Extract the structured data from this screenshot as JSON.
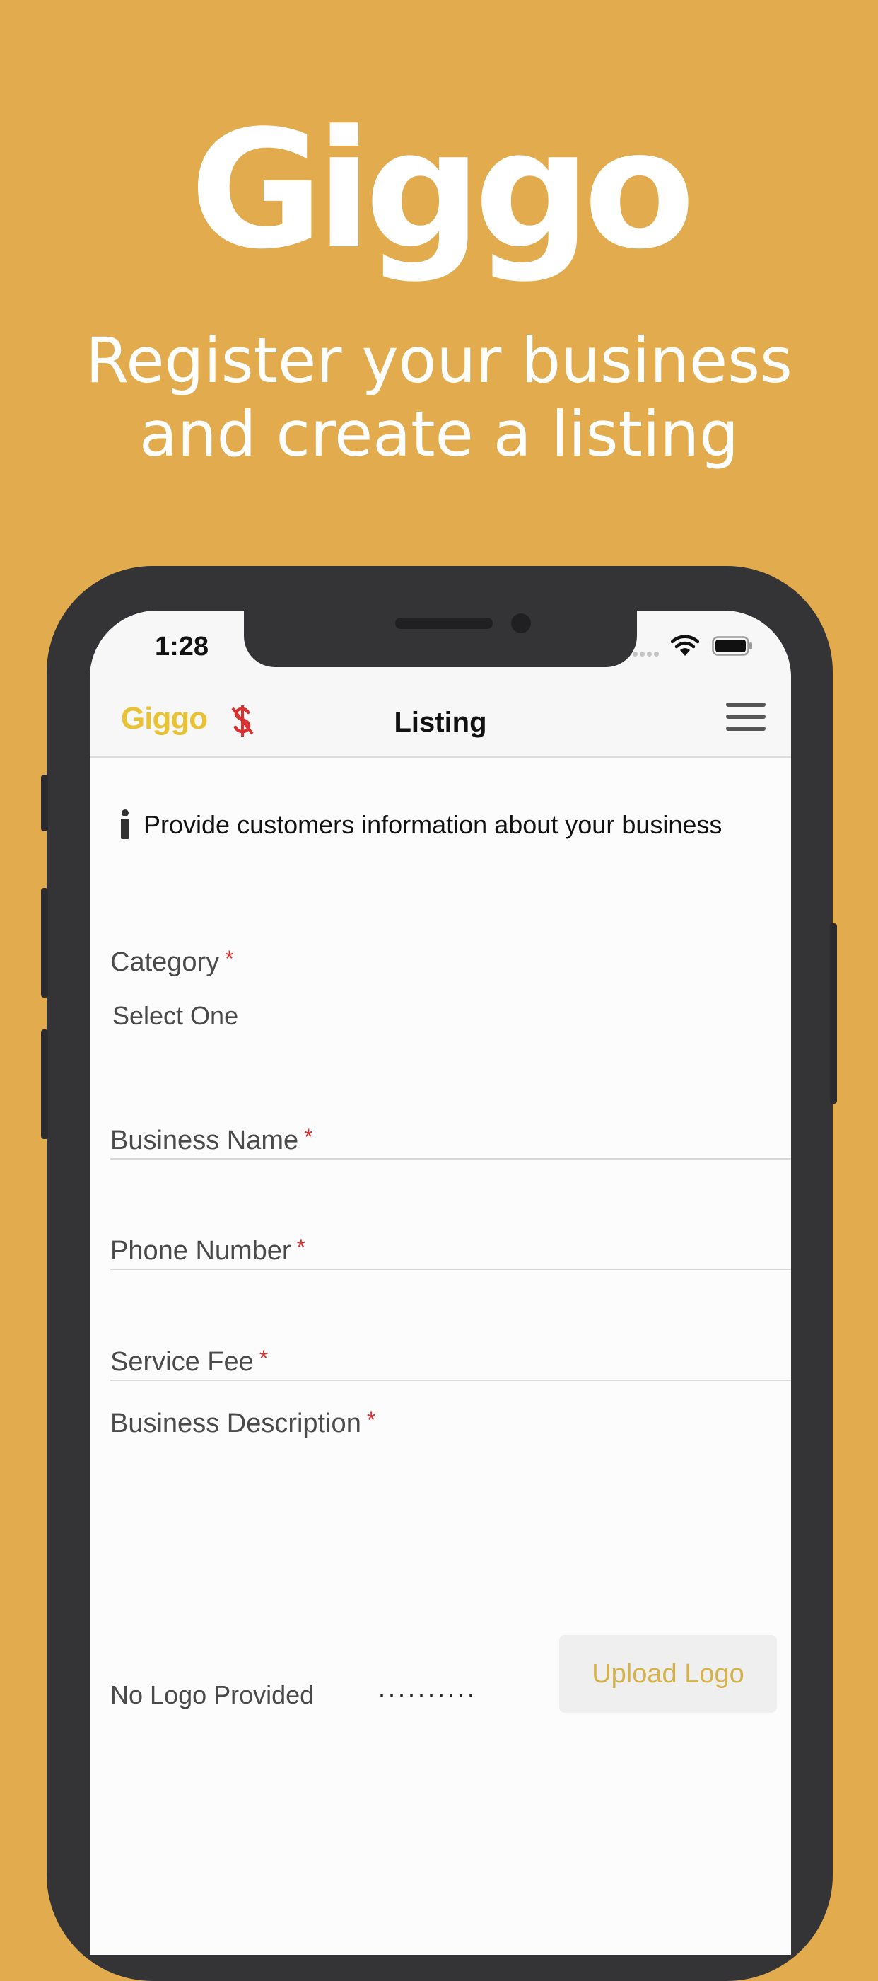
{
  "promo": {
    "logo_text": "Giggo",
    "headline": "Register your business\nand create a listing"
  },
  "status_bar": {
    "time": "1:28",
    "icons": [
      "signal-icon",
      "wifi-icon",
      "battery-icon"
    ]
  },
  "header": {
    "brand": "Giggo",
    "title": "Listing",
    "icons": [
      "dollar-icon",
      "menu-icon"
    ]
  },
  "info": {
    "text": "Provide customers information about your business",
    "icon": "info-icon"
  },
  "form": {
    "required_marker": "*",
    "category": {
      "label": "Category",
      "value": "Select One"
    },
    "business_name": {
      "label": "Business Name",
      "value": ""
    },
    "phone_number": {
      "label": "Phone Number",
      "value": ""
    },
    "service_fee": {
      "label": "Service Fee",
      "value": ""
    },
    "business_description": {
      "label": "Business Description",
      "value": ""
    },
    "logo": {
      "status": "No Logo Provided",
      "progress": "..........",
      "upload_label": "Upload Logo"
    }
  },
  "colors": {
    "background": "#E2AC4E",
    "brand": "#E8C232",
    "required": "#D63232",
    "upload_text": "#D6B24A"
  }
}
